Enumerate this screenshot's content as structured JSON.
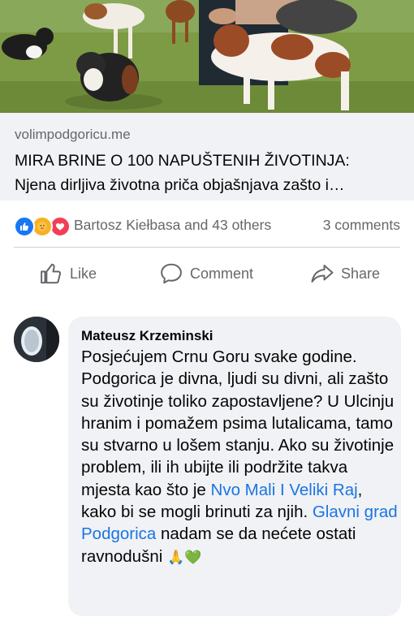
{
  "link_preview": {
    "domain": "volimpodgoricu.me",
    "title_line1": "MIRA BRINE O 100 NAPUŠTENIH ŽIVOTINJA:",
    "title_line2": "Njena dirljiva životna priča objašnjava zašto i…"
  },
  "reactions": {
    "icons": [
      "like-icon",
      "care-icon",
      "love-icon"
    ],
    "summary": "Bartosz Kiełbasa and 43 others",
    "comments": "3 comments"
  },
  "actions": {
    "like": "Like",
    "comment": "Comment",
    "share": "Share"
  },
  "comment": {
    "author": "Mateusz Krzeminski",
    "text_before_link1": "Posjećujem Crnu Goru svake godine. Podgorica je divna, ljudi su divni, ali zašto su životinje toliko zapostavljene? U Ulcinju hranim i pomažem psima lutalicama, tamo su stvarno u lošem stanju. Ako su životinje problem, ili ih ubijte ili podržite takva mjesta kao što je ",
    "link1": "Nvo Mali I Veliki Raj",
    "text_between": ", kako bi se mogli brinuti za njih. ",
    "link2": "Glavni grad Podgorica",
    "text_after": " nadam se da nećete ostati ravnodušni ",
    "emojis": "🙏💚"
  },
  "colors": {
    "link_blue": "#1b74e4",
    "secondary_text": "#65676b",
    "bubble_bg": "#f0f2f5"
  }
}
